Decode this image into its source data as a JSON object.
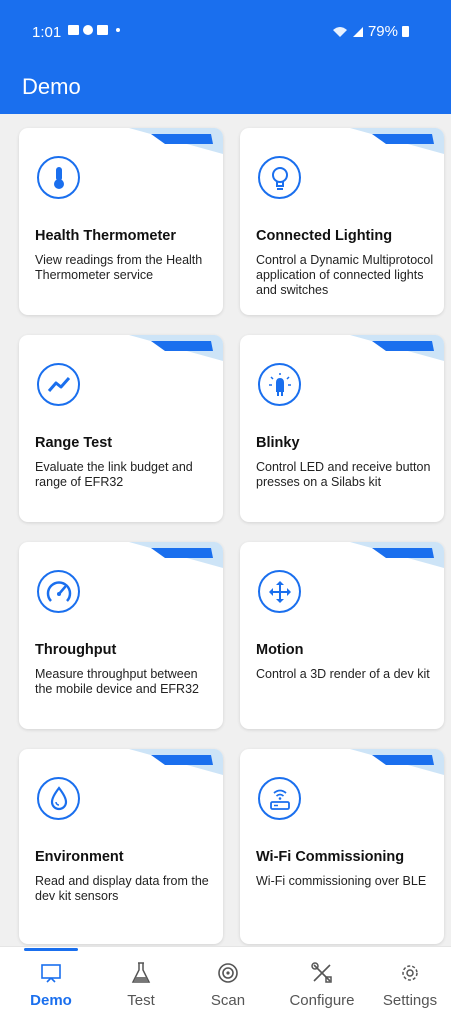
{
  "status": {
    "time": "1:01",
    "battery": "79%"
  },
  "appbar": {
    "title": "Demo"
  },
  "colors": {
    "accent": "#1a6fee",
    "ribbon": "#1a6fee",
    "ribbon_light": "#cde4f7"
  },
  "cards": [
    {
      "title": "Health Thermometer",
      "desc": "View readings from the Health Thermometer service",
      "icon": "thermometer-icon"
    },
    {
      "title": "Connected Lighting",
      "desc": "Control a Dynamic Multiprotocol application of connected lights and switches",
      "icon": "lightbulb-icon"
    },
    {
      "title": "Range Test",
      "desc": "Evaluate the link budget and range of EFR32",
      "icon": "range-test-icon"
    },
    {
      "title": "Blinky",
      "desc": "Control LED and receive button presses on a Silabs kit",
      "icon": "led-icon"
    },
    {
      "title": "Throughput",
      "desc": "Measure throughput between the mobile device and EFR32",
      "icon": "speedometer-icon"
    },
    {
      "title": "Motion",
      "desc": "Control a 3D render of a dev kit",
      "icon": "move-arrows-icon"
    },
    {
      "title": "Environment",
      "desc": "Read and display data from the dev kit sensors",
      "icon": "water-drop-icon"
    },
    {
      "title": "Wi-Fi Commissioning",
      "desc": "Wi-Fi commissioning over BLE",
      "icon": "wifi-router-icon"
    }
  ],
  "nav": [
    {
      "label": "Demo",
      "icon": "demo-icon",
      "active": true
    },
    {
      "label": "Test",
      "icon": "flask-icon",
      "active": false
    },
    {
      "label": "Scan",
      "icon": "scan-icon",
      "active": false
    },
    {
      "label": "Configure",
      "icon": "tools-icon",
      "active": false
    },
    {
      "label": "Settings",
      "icon": "gear-icon",
      "active": false
    }
  ]
}
